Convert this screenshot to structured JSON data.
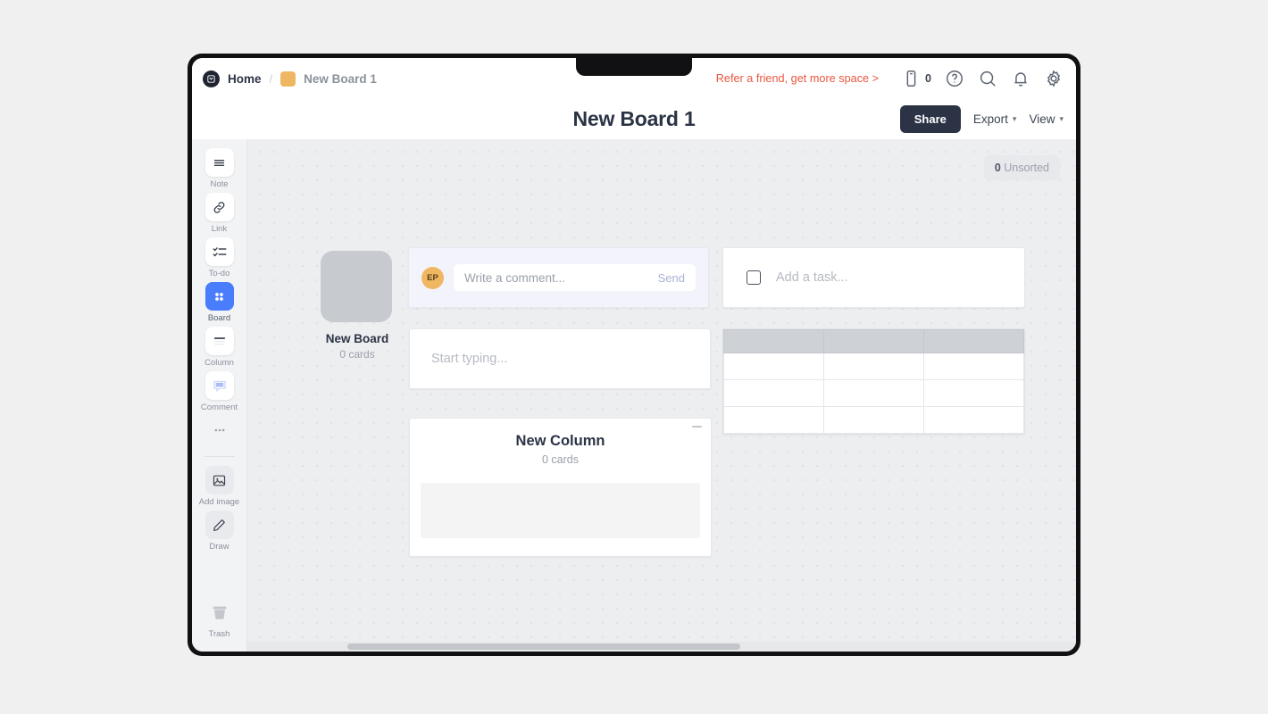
{
  "breadcrumb": {
    "logo_icon": "app-logo-icon",
    "home_label": "Home",
    "separator": "/",
    "current_label": "New Board 1"
  },
  "topbar": {
    "refer_label": "Refer a friend, get more space >",
    "mobile_icon": "mobile-device-icon",
    "mobile_count": "0",
    "help_icon": "help-circle-icon",
    "search_icon": "search-icon",
    "notifications_icon": "bell-icon",
    "settings_icon": "gear-icon"
  },
  "header": {
    "title": "New Board 1",
    "share_label": "Share",
    "export_label": "Export",
    "view_label": "View",
    "caret_icon": "chevron-down-icon"
  },
  "sidebar": {
    "items": [
      {
        "label": "Note",
        "icon": "note-lines-icon",
        "active": false
      },
      {
        "label": "Link",
        "icon": "link-chain-icon",
        "active": false
      },
      {
        "label": "To-do",
        "icon": "checklist-icon",
        "active": false
      },
      {
        "label": "Board",
        "icon": "board-grid-icon",
        "active": true
      },
      {
        "label": "Column",
        "icon": "column-icon",
        "active": false
      },
      {
        "label": "Comment",
        "icon": "comment-bubble-icon",
        "active": false
      }
    ],
    "more_icon": "more-dots-icon",
    "tools": [
      {
        "label": "Add image",
        "icon": "image-icon"
      },
      {
        "label": "Draw",
        "icon": "pencil-icon"
      }
    ],
    "trash_label": "Trash",
    "trash_icon": "trash-icon"
  },
  "canvas": {
    "unsorted_count": "0",
    "unsorted_label": "Unsorted",
    "board_card": {
      "name": "New Board",
      "cards_label": "0 cards"
    },
    "comment_widget": {
      "avatar_initials": "EP",
      "placeholder": "Write a comment...",
      "send_label": "Send"
    },
    "note_widget": {
      "placeholder": "Start typing..."
    },
    "todo_widget": {
      "placeholder": "Add a task...",
      "checkbox_icon": "checkbox-empty-icon"
    },
    "table_widget": {
      "columns": 3,
      "header_cells": [
        "",
        "",
        ""
      ],
      "rows": [
        [
          "",
          "",
          ""
        ],
        [
          "",
          "",
          ""
        ],
        [
          "",
          "",
          ""
        ]
      ]
    },
    "column_widget": {
      "title": "New Column",
      "cards_label": "0 cards",
      "minimize_icon": "minimize-icon"
    }
  },
  "colors": {
    "accent_blue": "#4a7dfc",
    "refer_orange": "#e8573f",
    "dark_navy": "#2b3344",
    "swatch_orange": "#f0b763",
    "canvas_gray": "#edeef0"
  }
}
